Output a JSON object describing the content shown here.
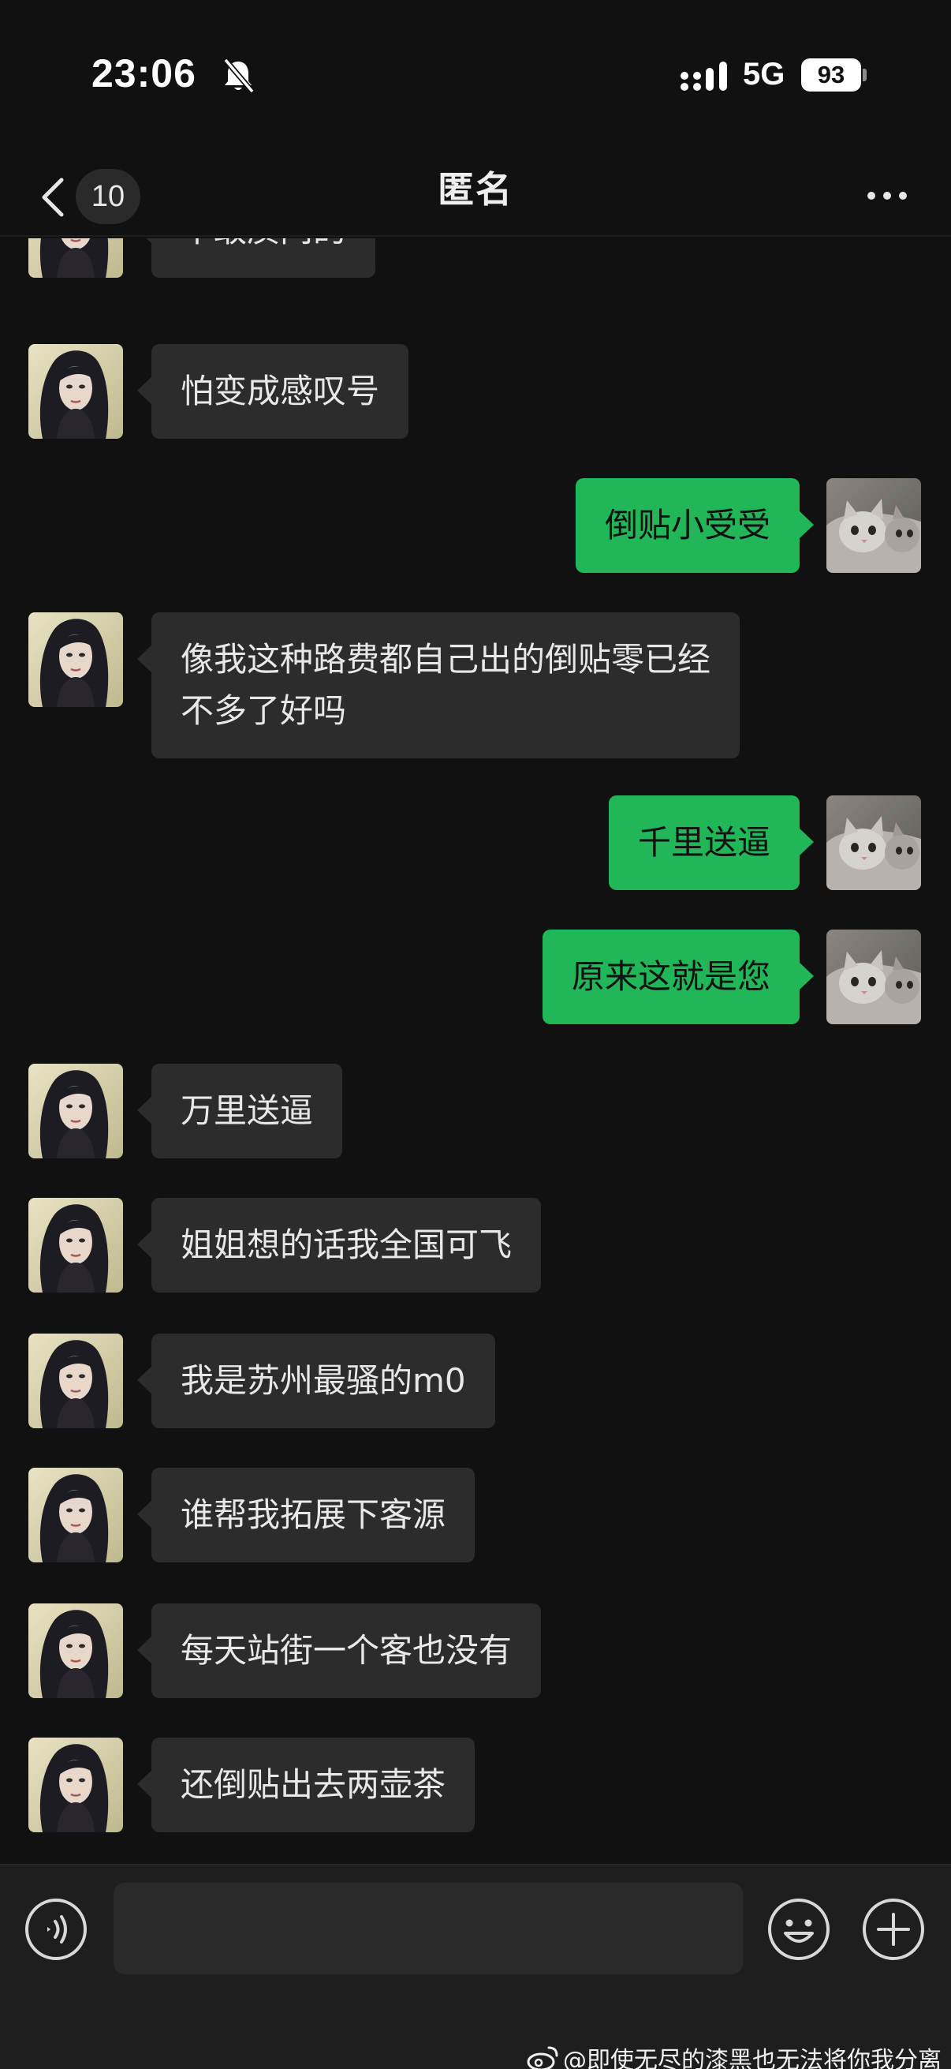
{
  "status_bar": {
    "time": "23:06",
    "network": "5G",
    "battery": "93"
  },
  "nav": {
    "unread_count": "10",
    "title": "匿名"
  },
  "avatars": {
    "contact": "portrait of long-haired woman",
    "self": "kitten photo"
  },
  "messages": [
    {
      "side": "in",
      "text": "不敢质问的"
    },
    {
      "side": "in",
      "text": "怕变成感叹号"
    },
    {
      "side": "out",
      "text": "倒贴小受受"
    },
    {
      "side": "in",
      "text": "像我这种路费都自己出的倒贴零已经\n不多了好吗"
    },
    {
      "side": "out",
      "text": "千里送逼"
    },
    {
      "side": "out",
      "text": "原来这就是您"
    },
    {
      "side": "in",
      "text": "万里送逼"
    },
    {
      "side": "in",
      "text": "姐姐想的话我全国可飞"
    },
    {
      "side": "in",
      "text": "我是苏州最骚的m0"
    },
    {
      "side": "in",
      "text": "谁帮我拓展下客源"
    },
    {
      "side": "in",
      "text": "每天站街一个客也没有"
    },
    {
      "side": "in",
      "text": "还倒贴出去两壶茶"
    }
  ],
  "input_bar": {
    "placeholder": "",
    "value": ""
  },
  "watermark": "@即使无尽的漆黑也无法将你我分离",
  "colors": {
    "background": "#111111",
    "incoming_bubble": "#2c2c2c",
    "outgoing_bubble": "#21b658"
  }
}
